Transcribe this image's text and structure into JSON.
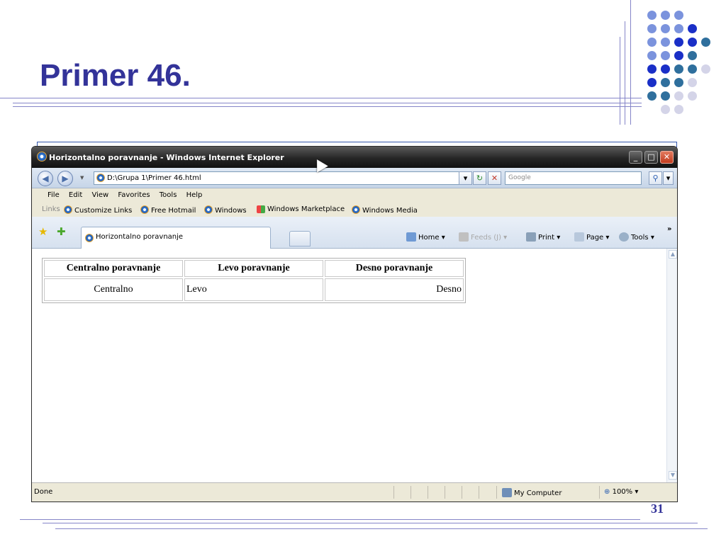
{
  "slide": {
    "title": "Primer 46.",
    "page_number": "31",
    "dot_colors": [
      "#7b93dd",
      "#1a2fc7",
      "#2f6f9d",
      "#d4d4e8"
    ]
  },
  "browser": {
    "window_title": "Horizontalno poravnanje - Windows Internet Explorer",
    "address": "D:\\Grupa 1\\Primer 46.html",
    "search_placeholder": "Google",
    "menu": [
      "File",
      "Edit",
      "View",
      "Favorites",
      "Tools",
      "Help"
    ],
    "links_label": "Links",
    "links": [
      "Customize Links",
      "Free Hotmail",
      "Windows",
      "Windows Marketplace",
      "Windows Media"
    ],
    "tab_title": "Horizontalno poravnanje",
    "commands": {
      "home": "Home",
      "feeds": "Feeds (J)",
      "print": "Print",
      "page": "Page",
      "tools": "Tools",
      "more": "»"
    },
    "status": {
      "text": "Done",
      "zone": "My Computer",
      "zoom": "100%"
    }
  },
  "page": {
    "table": {
      "headers": [
        "Centralno poravnanje",
        "Levo poravnanje",
        "Desno poravnanje"
      ],
      "row": [
        "Centralno",
        "Levo",
        "Desno"
      ]
    }
  }
}
